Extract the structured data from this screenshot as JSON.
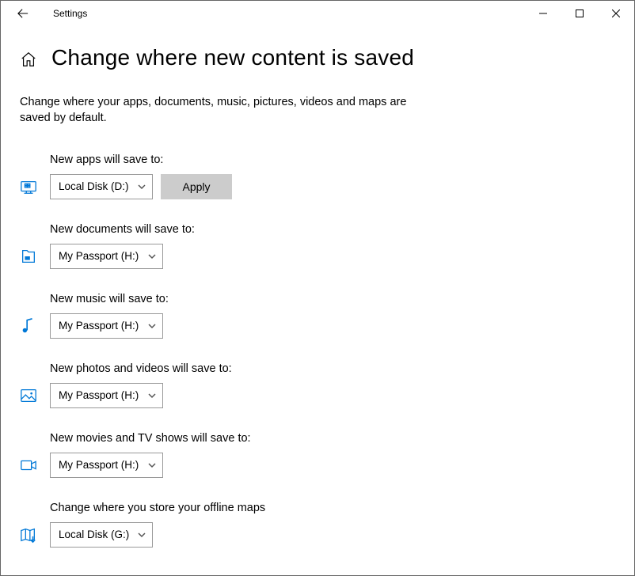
{
  "window": {
    "title": "Settings"
  },
  "page": {
    "title": "Change where new content is saved",
    "description": "Change where your apps, documents, music, pictures, videos and maps are saved by default."
  },
  "apply_label": "Apply",
  "rows": {
    "apps": {
      "label": "New apps will save to:",
      "value": "Local Disk (D:)",
      "show_apply": true
    },
    "documents": {
      "label": "New documents will save to:",
      "value": "My Passport (H:)"
    },
    "music": {
      "label": "New music will save to:",
      "value": "My Passport (H:)"
    },
    "photos": {
      "label": "New photos and videos will save to:",
      "value": "My Passport (H:)"
    },
    "movies": {
      "label": "New movies and TV shows will save to:",
      "value": "My Passport (H:)"
    },
    "maps": {
      "label": "Change where you store your offline maps",
      "value": "Local Disk (G:)"
    }
  }
}
